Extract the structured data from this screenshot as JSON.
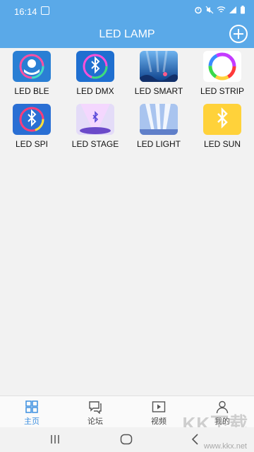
{
  "status": {
    "time": "16:14"
  },
  "app_bar": {
    "title": "LED LAMP"
  },
  "apps": [
    {
      "label": "LED BLE",
      "icon": "hands-bulb-icon"
    },
    {
      "label": "LED DMX",
      "icon": "bluetooth-ring-icon"
    },
    {
      "label": "LED SMART",
      "icon": "underwater-scene-icon"
    },
    {
      "label": "LED STRIP",
      "icon": "rainbow-ring-light-icon"
    },
    {
      "label": "LED SPI",
      "icon": "bluetooth-rainbow-icon"
    },
    {
      "label": "LED STAGE",
      "icon": "stage-spotlight-icon"
    },
    {
      "label": "LED LIGHT",
      "icon": "stage-beams-icon"
    },
    {
      "label": "LED SUN",
      "icon": "bluetooth-yellow-icon"
    }
  ],
  "bottom_nav": [
    {
      "label": "主页",
      "icon": "home-grid-icon",
      "active": true
    },
    {
      "label": "论坛",
      "icon": "forum-icon",
      "active": false
    },
    {
      "label": "视频",
      "icon": "video-icon",
      "active": false
    },
    {
      "label": "我的",
      "icon": "profile-icon",
      "active": false
    }
  ],
  "colors": {
    "primary": "#5aa9e8",
    "background": "#f2f2f2",
    "active_tab": "#3a8ee0"
  },
  "watermark": {
    "logo_text": "KK下载",
    "url": "www.kkx.net"
  }
}
